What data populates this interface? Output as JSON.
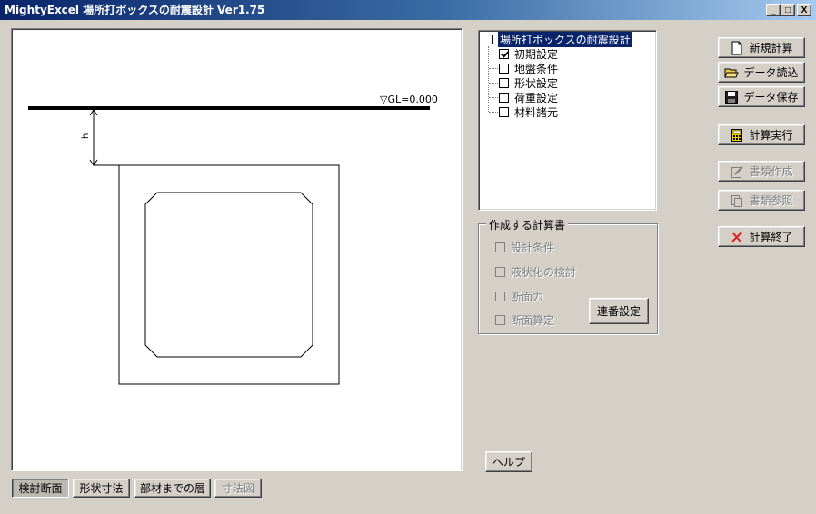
{
  "window": {
    "title": "MightyExcel 場所打ボックスの耐震設計  Ver1.75",
    "controls": {
      "minimize": "_",
      "maximize": "□",
      "close": "X"
    }
  },
  "drawing": {
    "gl_label": "▽GL=0.000",
    "dim_label": "h"
  },
  "view_tabs": [
    {
      "label": "検討断面",
      "state": "active"
    },
    {
      "label": "形状寸法",
      "state": "normal"
    },
    {
      "label": "部材までの層",
      "state": "normal"
    },
    {
      "label": "寸法図",
      "state": "disabled"
    }
  ],
  "tree": {
    "root": {
      "label": "場所打ボックスの耐震設計",
      "checked": false
    },
    "items": [
      {
        "label": "初期設定",
        "checked": true
      },
      {
        "label": "地盤条件",
        "checked": false
      },
      {
        "label": "形状設定",
        "checked": false
      },
      {
        "label": "荷重設定",
        "checked": false
      },
      {
        "label": "材料諸元",
        "checked": false
      }
    ]
  },
  "report_group": {
    "title": "作成する計算書",
    "options": [
      {
        "label": "設計条件",
        "checked": false
      },
      {
        "label": "液状化の検討",
        "checked": false
      },
      {
        "label": "断面力",
        "checked": false
      },
      {
        "label": "断面算定",
        "checked": false
      }
    ],
    "serial_button": "連番設定"
  },
  "help_button": "ヘルプ",
  "actions": {
    "new_calc": "新規計算",
    "load_data": "データ読込",
    "save_data": "データ保存",
    "run_calc": "計算実行",
    "create_docs": "書類作成",
    "view_docs": "書類参照",
    "exit_calc": "計算終了"
  },
  "colors": {
    "title_start": "#0a246a",
    "title_end": "#a6caf0",
    "face": "#d4d0c8",
    "exit_icon": "#e02020",
    "run_icon": "#f0d000"
  }
}
